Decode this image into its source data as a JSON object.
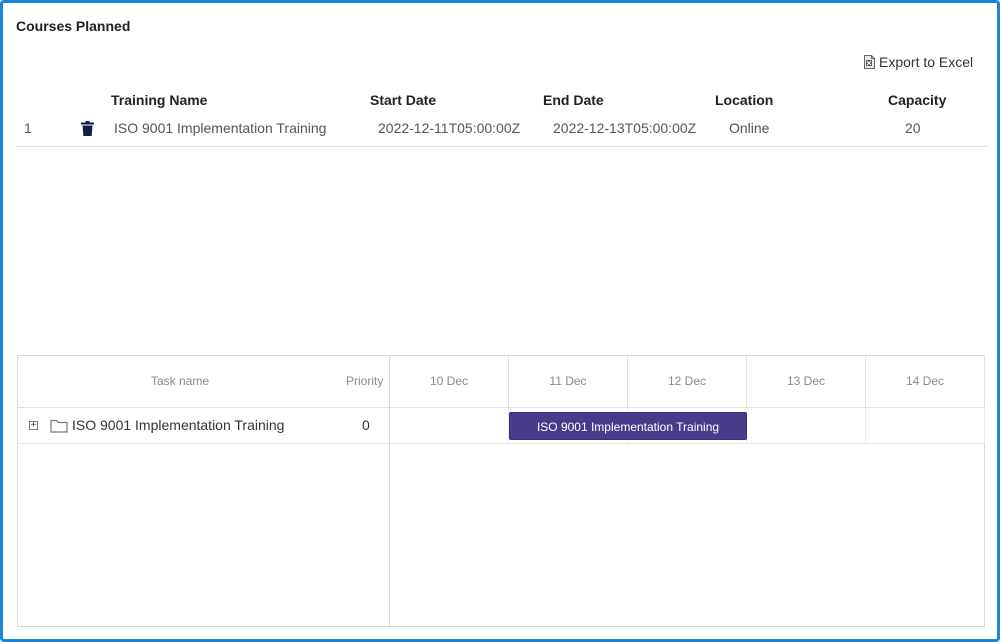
{
  "section": {
    "title": "Courses Planned",
    "export_label": "Export to Excel"
  },
  "table": {
    "headers": {
      "training_name": "Training Name",
      "start_date": "Start Date",
      "end_date": "End Date",
      "location": "Location",
      "capacity": "Capacity"
    },
    "rows": [
      {
        "index": "1",
        "training_name": "ISO 9001 Implementation Training",
        "start_date": "2022-12-11T05:00:00Z",
        "end_date": "2022-12-13T05:00:00Z",
        "location": "Online",
        "capacity": "20"
      }
    ]
  },
  "gantt": {
    "headers": {
      "task_name": "Task name",
      "priority": "Priority"
    },
    "days": [
      "10 Dec",
      "11 Dec",
      "12 Dec",
      "13 Dec",
      "14 Dec"
    ],
    "tasks": [
      {
        "name": "ISO 9001 Implementation Training",
        "priority": "0",
        "bar_label": "ISO 9001 Implementation Training",
        "start_day": "11 Dec",
        "end_day": "12 Dec"
      }
    ],
    "bar_color": "#4a3a8c"
  },
  "colors": {
    "frame_border": "#1a84d6"
  }
}
